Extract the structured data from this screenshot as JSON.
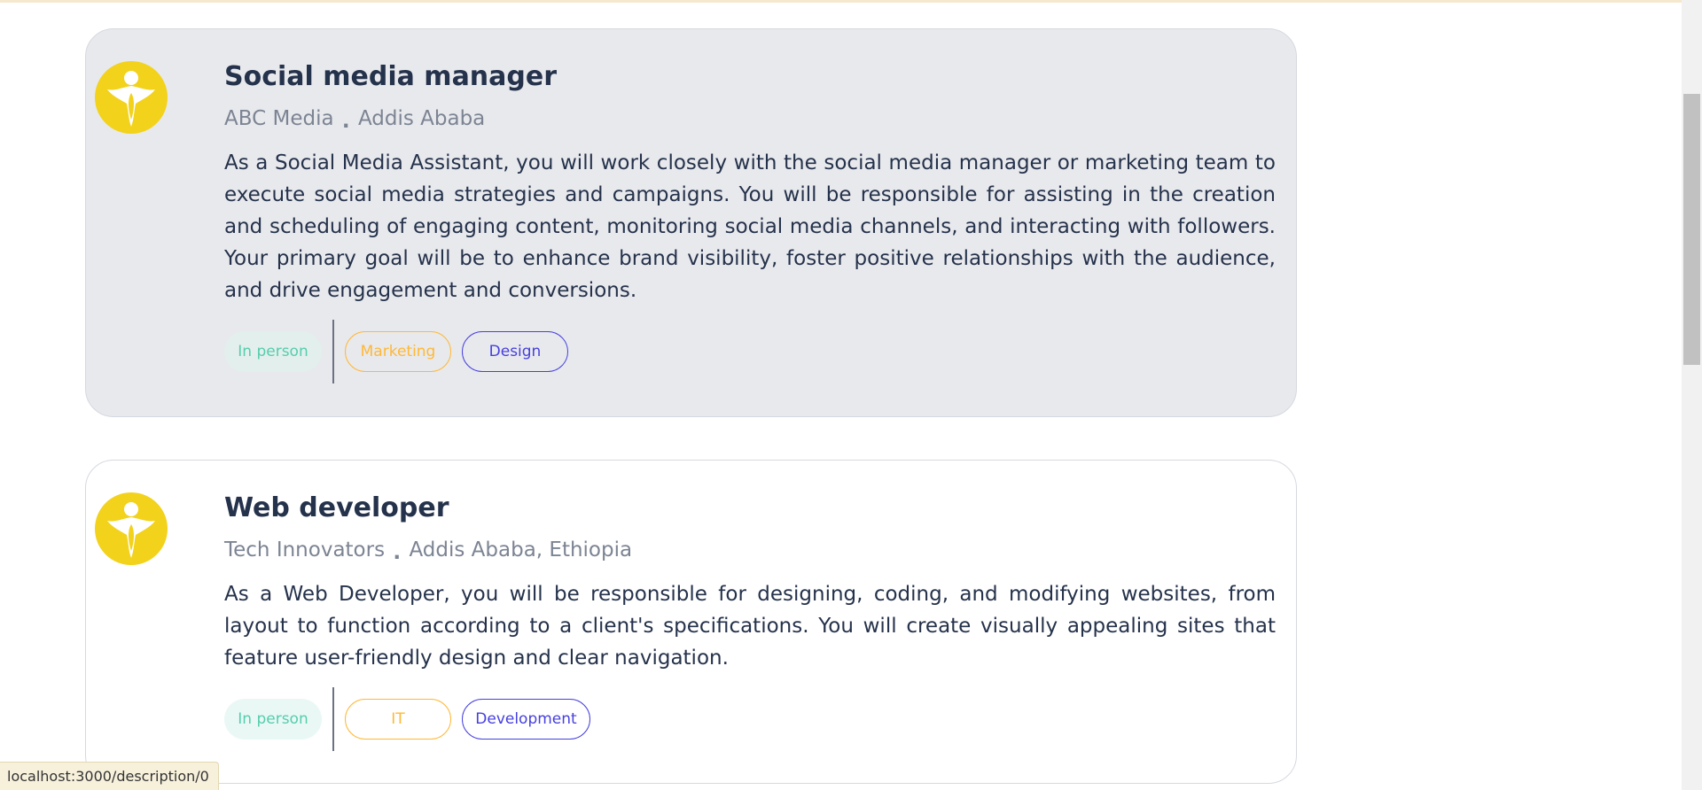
{
  "jobs": [
    {
      "title": "Social media manager",
      "company": "ABC Media",
      "separator": ".",
      "location": "Addis Ababa",
      "description": "As a Social Media Assistant, you will work closely with the social media manager or marketing team to execute social media strategies and campaigns. You will be responsible for assisting in the creation and scheduling of engaging content, monitoring social media channels, and interacting with followers. Your primary goal will be to enhance brand visibility, foster positive relationships with the audience, and drive engagement and conversions.",
      "type": "In person",
      "categories": [
        "Marketing",
        "Design"
      ],
      "logo_icon": "company-logo-icon",
      "hovered": true
    },
    {
      "title": "Web developer",
      "company": "Tech Innovators",
      "separator": ".",
      "location": "Addis Ababa, Ethiopia",
      "description": "As a Web Developer, you will be responsible for designing, coding, and modifying websites, from layout to function according to a client's specifications. You will create visually appealing sites that feature user-friendly design and clear navigation.",
      "type": "In person",
      "categories": [
        "IT",
        "Development"
      ],
      "logo_icon": "company-logo-icon",
      "hovered": false
    }
  ],
  "status_bar": {
    "url": "localhost:3000/description/0"
  },
  "colors": {
    "title": "#25324b",
    "meta": "#7c8493",
    "type_tag": "#56cdad",
    "category_primary": "#ffb836",
    "category_secondary": "#4640de",
    "logo": "#f2d21b",
    "hover_card_bg": "#e8e9ed"
  }
}
